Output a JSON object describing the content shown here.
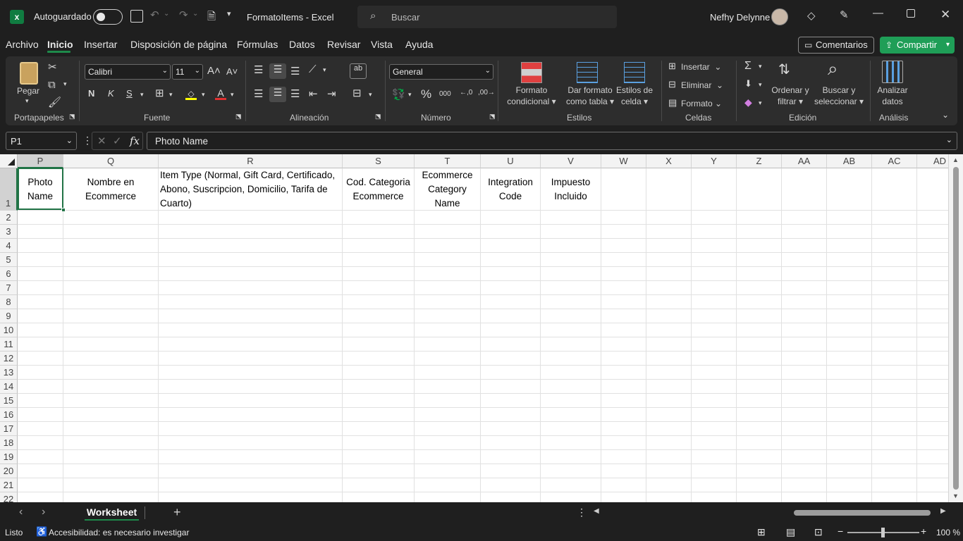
{
  "titlebar": {
    "autosave_label": "Autoguardado",
    "filename": "FormatoItems",
    "separator": " - ",
    "app": "Excel",
    "search_placeholder": "Buscar",
    "user": "Nefhy Delynne"
  },
  "menu": [
    "Archivo",
    "Inicio",
    "Insertar",
    "Disposición de página",
    "Fórmulas",
    "Datos",
    "Revisar",
    "Vista",
    "Ayuda"
  ],
  "menu_active": "Inicio",
  "comments_label": "Comentarios",
  "share_label": "Compartir",
  "ribbon": {
    "paste": "Pegar",
    "font_name": "Calibri",
    "font_size": "11",
    "bold": "N",
    "italic": "K",
    "underline": "S",
    "number_format": "General",
    "cond_format": [
      "Formato",
      "condicional"
    ],
    "table_format": [
      "Dar formato",
      "como tabla"
    ],
    "cell_styles": [
      "Estilos de",
      "celda"
    ],
    "insert": "Insertar",
    "delete": "Eliminar",
    "format": "Formato",
    "sort": [
      "Ordenar y",
      "filtrar"
    ],
    "find": [
      "Buscar y",
      "seleccionar"
    ],
    "analyze": [
      "Analizar",
      "datos"
    ],
    "groups": [
      "Portapapeles",
      "Fuente",
      "Alineación",
      "Número",
      "Estilos",
      "Celdas",
      "Edición",
      "Análisis"
    ]
  },
  "formula_bar": {
    "name_box": "P1",
    "fx": "fx",
    "content": "Photo Name"
  },
  "columns": [
    "P",
    "Q",
    "R",
    "S",
    "T",
    "U",
    "V",
    "W",
    "X",
    "Y",
    "Z",
    "AA",
    "AB",
    "AC",
    "AD"
  ],
  "rows": [
    "1",
    "2",
    "3",
    "4",
    "5",
    "6",
    "7",
    "8",
    "9",
    "10",
    "11",
    "12",
    "13",
    "14",
    "15",
    "16",
    "17",
    "18",
    "19",
    "20",
    "21",
    "22"
  ],
  "header_cells": {
    "P": "Photo Name",
    "Q": "Nombre en Ecommerce",
    "R": "Item Type (Normal, Gift Card, Certificado, Abono, Suscripcion, Domicilio, Tarifa de Cuarto)",
    "S": "Cod. Categoria Ecommerce",
    "T": "Ecommerce Category Name",
    "U": "Integration Code",
    "V": "Impuesto Incluido"
  },
  "sheet_tab": "Worksheet",
  "status": {
    "ready": "Listo",
    "accessibility": "Accesibilidad: es necesario investigar",
    "zoom": "100 %"
  },
  "colors": {
    "accent_green": "#1e8a4a",
    "share_green": "#1f9e57",
    "selection": "#217346"
  }
}
